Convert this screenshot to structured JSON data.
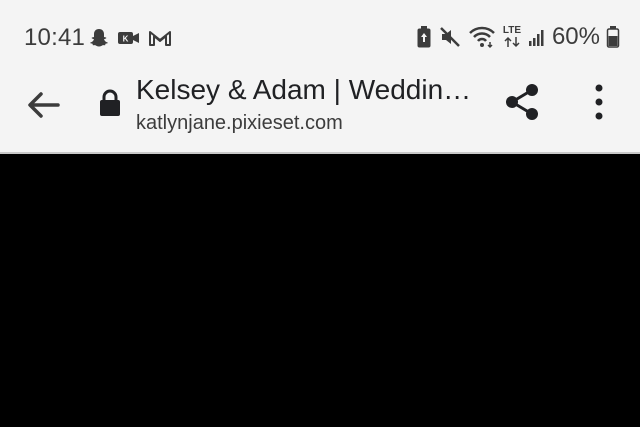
{
  "status_bar": {
    "time": "10:41",
    "battery_percent": "60%",
    "network_label": "LTE",
    "notification_icons": [
      "snapchat-icon",
      "video-call-icon",
      "gmail-icon"
    ],
    "system_icons": [
      "battery-saver-icon",
      "mute-icon",
      "wifi-icon",
      "lte-icon",
      "signal-icon",
      "battery-icon"
    ]
  },
  "toolbar": {
    "page_title": "Kelsey & Adam | Weddin…",
    "url": "katlynjane.pixieset.com"
  },
  "colors": {
    "toolbar_bg": "#f4f4f4",
    "content_bg": "#000000",
    "icon": "#3c3c3c"
  }
}
